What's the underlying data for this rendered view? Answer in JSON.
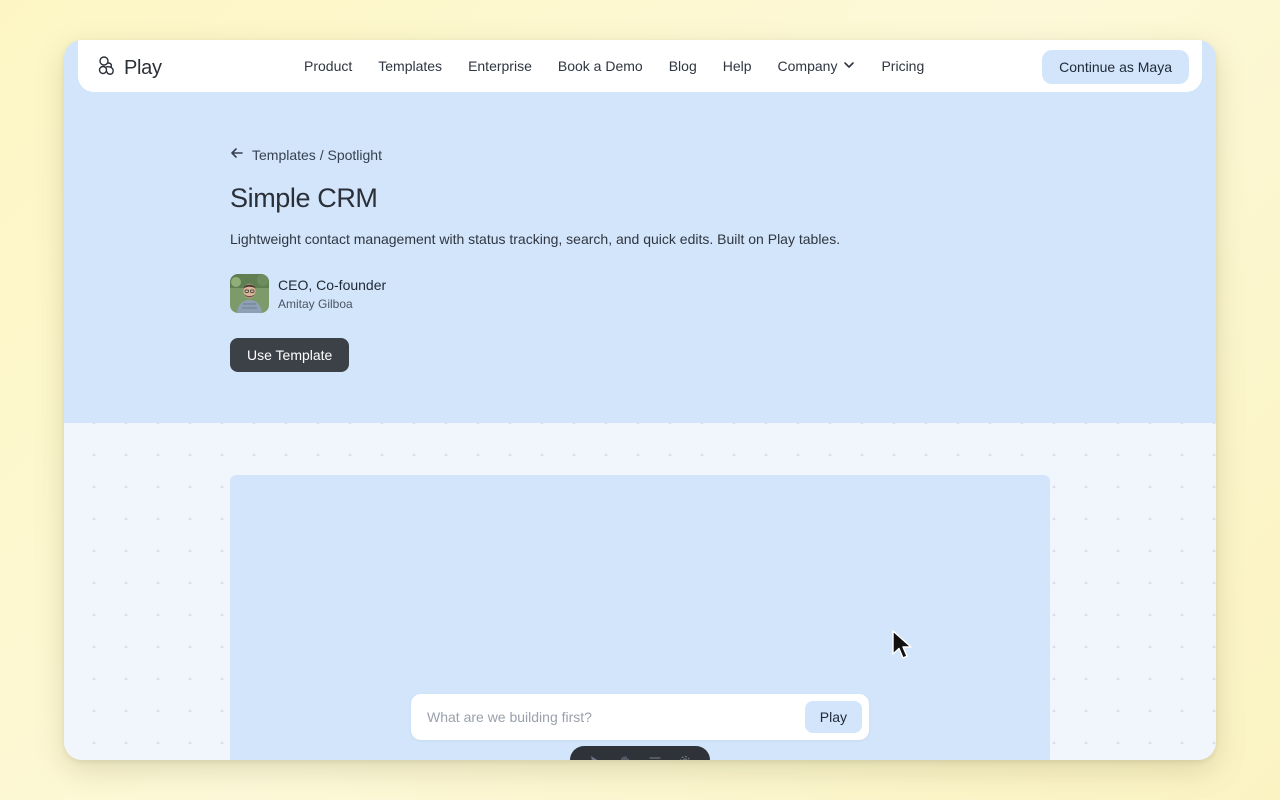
{
  "brand": {
    "name": "Play",
    "icon": "play-logo-icon"
  },
  "nav": {
    "links": [
      {
        "label": "Product"
      },
      {
        "label": "Templates"
      },
      {
        "label": "Enterprise"
      },
      {
        "label": "Book a Demo"
      },
      {
        "label": "Blog"
      },
      {
        "label": "Help"
      },
      {
        "label": "Company"
      },
      {
        "label": "Pricing"
      }
    ],
    "cta_label": "Continue as Maya"
  },
  "breadcrumb": {
    "text": "Templates / Spotlight",
    "icon": "arrow-left-icon"
  },
  "template": {
    "title": "Simple CRM",
    "description": "Lightweight contact management with status tracking, search, and quick edits. Built on Play tables.",
    "author": {
      "role": "CEO, Co-founder",
      "name": "Amitay Gilboa"
    },
    "use_label": "Use Template"
  },
  "prompt": {
    "placeholder": "What are we building first?",
    "value": "",
    "submit_label": "Play"
  },
  "toolbar": {
    "icons": [
      "pointer-icon",
      "hand-icon",
      "text-icon",
      "gear-icon"
    ]
  },
  "colors": {
    "hero": "#d3e5fb",
    "dark_button": "#3c4148",
    "page_bg": "#fdf6c4"
  }
}
